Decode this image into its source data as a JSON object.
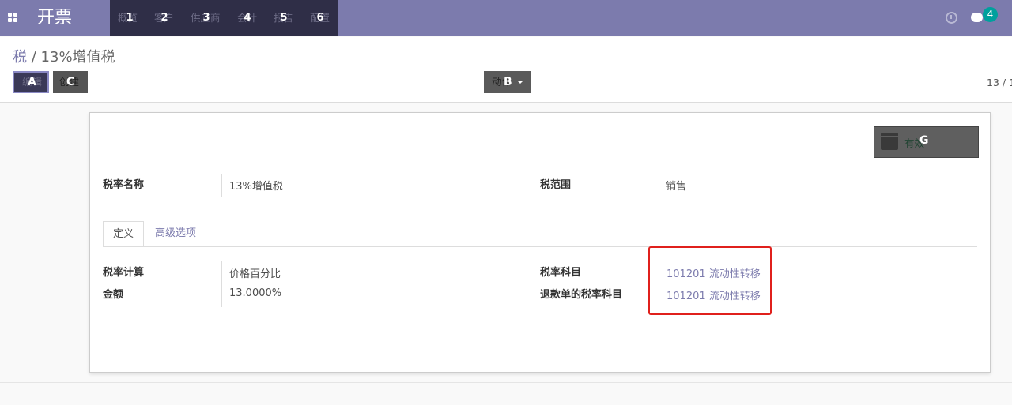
{
  "navbar": {
    "app_title": "开票",
    "menu": [
      {
        "label": "概览",
        "badge": "1"
      },
      {
        "label": "客户",
        "badge": "2"
      },
      {
        "label": "供应商",
        "badge": "3"
      },
      {
        "label": "会计",
        "badge": "4"
      },
      {
        "label": "报告",
        "badge": "5"
      },
      {
        "label": "配置",
        "badge": "6"
      }
    ],
    "messages_count": "4"
  },
  "breadcrumb": {
    "parent": "税",
    "separator": "/",
    "current": "13%增值税"
  },
  "toolbar": {
    "edit_label": "编辑",
    "edit_badge": "A",
    "create_label": "创建",
    "create_badge": "C",
    "action_label": "动作",
    "action_badge": "B"
  },
  "pager": "13 / 1",
  "form": {
    "active_button": {
      "label": "有效",
      "badge": "G"
    },
    "name_label": "税率名称",
    "name_value": "13%增值税",
    "scope_label": "税范围",
    "scope_value": "销售",
    "tabs": [
      {
        "label": "定义",
        "active": true
      },
      {
        "label": "高级选项",
        "active": false
      }
    ],
    "computation_label": "税率计算",
    "computation_value": "价格百分比",
    "amount_label": "金额",
    "amount_value": "13.0000%",
    "account_label": "税率科目",
    "account_value": "101201 流动性转移",
    "refund_account_label": "退款单的税率科目",
    "refund_account_value": "101201 流动性转移"
  },
  "colors": {
    "brand": "#7c7bad",
    "menu_bg": "#2f2e47",
    "highlight": "#e0201c",
    "badge": "#00a09d"
  }
}
